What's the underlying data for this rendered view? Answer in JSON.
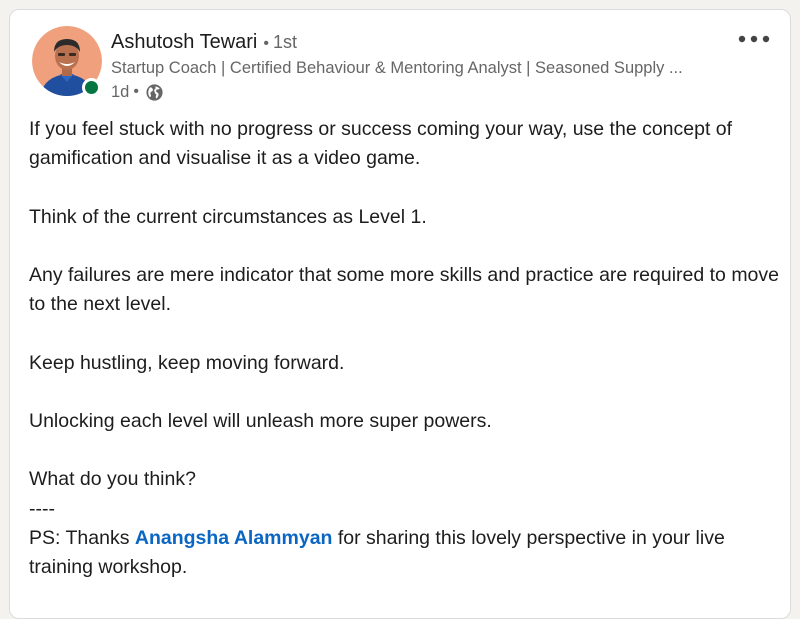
{
  "post": {
    "author": {
      "name": "Ashutosh Tewari",
      "connection_degree": "1st",
      "headline": "Startup Coach | Certified Behaviour & Mentoring Analyst | Seasoned Supply ...",
      "time_ago": "1d",
      "visibility_icon": "globe-icon",
      "online": true
    },
    "more_icon": "more-dots-icon",
    "paragraphs": [
      "If you feel stuck with no progress or success coming your way, use the concept of gamification and visualise it as a video game.",
      "Think of the current circumstances as Level 1.",
      "Any failures are mere indicator that some more skills and practice are required to move to the next level.",
      "Keep hustling, keep moving forward.",
      "Unlocking each level will unleash more super powers."
    ],
    "question": "What do you think?",
    "divider": "----",
    "ps_prefix": "PS: Thanks ",
    "mention": "Anangsha Alammyan",
    "ps_suffix": " for sharing this lovely perspective in your live training workshop."
  },
  "colors": {
    "link": "#0a66c2",
    "presence": "#057642",
    "text": "#1d1d1d",
    "muted": "#666666"
  }
}
